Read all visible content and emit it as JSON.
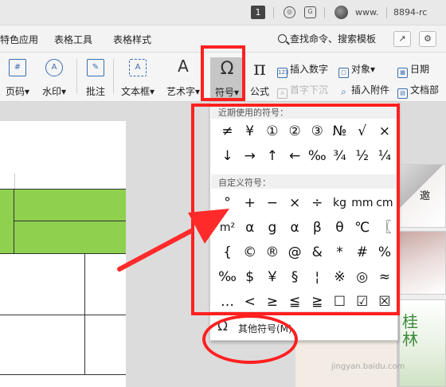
{
  "titlebar": {
    "badge": "1",
    "user": "www.",
    "id": "8894-rc"
  },
  "menu": {
    "items": [
      "特色应用",
      "表格工具",
      "表格样式"
    ],
    "search": "查找命令、搜索模板"
  },
  "ribbon": {
    "pagenum": "页码",
    "watermark": "水印",
    "comment": "批注",
    "textbox": "文本框",
    "wordart": "艺术字",
    "symbol": "符号",
    "formula": "公式",
    "insert_number": "插入数字",
    "object": "对象",
    "date": "日期",
    "drop_cap": "首字下沉",
    "attachment": "插入附件",
    "doc_part": "文档部"
  },
  "symbol_panel": {
    "recent_title": "近期使用的符号：",
    "recent": [
      [
        "≠",
        "¥",
        "①",
        "②",
        "③",
        "№",
        "√",
        "×"
      ],
      [
        "↓",
        "→",
        "↑",
        "←",
        "‰",
        "¾",
        "½",
        "¼"
      ]
    ],
    "custom_title": "自定义符号：",
    "custom": [
      [
        "°",
        "+",
        "−",
        "×",
        "÷",
        "kg",
        "mm",
        "cm"
      ],
      [
        "m²",
        "α",
        "g",
        "α",
        "β",
        "θ",
        "℃",
        "〖"
      ],
      [
        "{",
        "©",
        "®",
        "@",
        "&",
        "*",
        "#",
        "%"
      ],
      [
        "‰",
        "$",
        "￥",
        "§",
        "¦",
        "※",
        "◎",
        "≈"
      ],
      [
        "…",
        "<",
        "≥",
        "≦",
        "≧",
        "☐",
        "☑",
        "☒"
      ]
    ],
    "other": "其他符号(M)"
  },
  "watermark_text": "jingyan.baidu.com"
}
